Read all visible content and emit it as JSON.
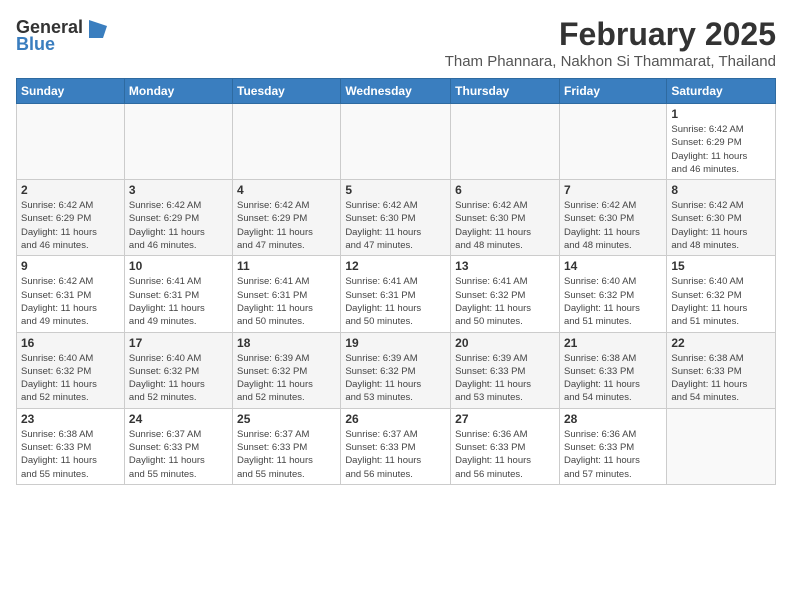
{
  "logo": {
    "general": "General",
    "blue": "Blue"
  },
  "title": {
    "main": "February 2025",
    "sub": "Tham Phannara, Nakhon Si Thammarat, Thailand"
  },
  "headers": [
    "Sunday",
    "Monday",
    "Tuesday",
    "Wednesday",
    "Thursday",
    "Friday",
    "Saturday"
  ],
  "weeks": [
    [
      {
        "day": "",
        "info": ""
      },
      {
        "day": "",
        "info": ""
      },
      {
        "day": "",
        "info": ""
      },
      {
        "day": "",
        "info": ""
      },
      {
        "day": "",
        "info": ""
      },
      {
        "day": "",
        "info": ""
      },
      {
        "day": "1",
        "info": "Sunrise: 6:42 AM\nSunset: 6:29 PM\nDaylight: 11 hours\nand 46 minutes."
      }
    ],
    [
      {
        "day": "2",
        "info": "Sunrise: 6:42 AM\nSunset: 6:29 PM\nDaylight: 11 hours\nand 46 minutes."
      },
      {
        "day": "3",
        "info": "Sunrise: 6:42 AM\nSunset: 6:29 PM\nDaylight: 11 hours\nand 46 minutes."
      },
      {
        "day": "4",
        "info": "Sunrise: 6:42 AM\nSunset: 6:29 PM\nDaylight: 11 hours\nand 47 minutes."
      },
      {
        "day": "5",
        "info": "Sunrise: 6:42 AM\nSunset: 6:30 PM\nDaylight: 11 hours\nand 47 minutes."
      },
      {
        "day": "6",
        "info": "Sunrise: 6:42 AM\nSunset: 6:30 PM\nDaylight: 11 hours\nand 48 minutes."
      },
      {
        "day": "7",
        "info": "Sunrise: 6:42 AM\nSunset: 6:30 PM\nDaylight: 11 hours\nand 48 minutes."
      },
      {
        "day": "8",
        "info": "Sunrise: 6:42 AM\nSunset: 6:30 PM\nDaylight: 11 hours\nand 48 minutes."
      }
    ],
    [
      {
        "day": "9",
        "info": "Sunrise: 6:42 AM\nSunset: 6:31 PM\nDaylight: 11 hours\nand 49 minutes."
      },
      {
        "day": "10",
        "info": "Sunrise: 6:41 AM\nSunset: 6:31 PM\nDaylight: 11 hours\nand 49 minutes."
      },
      {
        "day": "11",
        "info": "Sunrise: 6:41 AM\nSunset: 6:31 PM\nDaylight: 11 hours\nand 50 minutes."
      },
      {
        "day": "12",
        "info": "Sunrise: 6:41 AM\nSunset: 6:31 PM\nDaylight: 11 hours\nand 50 minutes."
      },
      {
        "day": "13",
        "info": "Sunrise: 6:41 AM\nSunset: 6:32 PM\nDaylight: 11 hours\nand 50 minutes."
      },
      {
        "day": "14",
        "info": "Sunrise: 6:40 AM\nSunset: 6:32 PM\nDaylight: 11 hours\nand 51 minutes."
      },
      {
        "day": "15",
        "info": "Sunrise: 6:40 AM\nSunset: 6:32 PM\nDaylight: 11 hours\nand 51 minutes."
      }
    ],
    [
      {
        "day": "16",
        "info": "Sunrise: 6:40 AM\nSunset: 6:32 PM\nDaylight: 11 hours\nand 52 minutes."
      },
      {
        "day": "17",
        "info": "Sunrise: 6:40 AM\nSunset: 6:32 PM\nDaylight: 11 hours\nand 52 minutes."
      },
      {
        "day": "18",
        "info": "Sunrise: 6:39 AM\nSunset: 6:32 PM\nDaylight: 11 hours\nand 52 minutes."
      },
      {
        "day": "19",
        "info": "Sunrise: 6:39 AM\nSunset: 6:32 PM\nDaylight: 11 hours\nand 53 minutes."
      },
      {
        "day": "20",
        "info": "Sunrise: 6:39 AM\nSunset: 6:33 PM\nDaylight: 11 hours\nand 53 minutes."
      },
      {
        "day": "21",
        "info": "Sunrise: 6:38 AM\nSunset: 6:33 PM\nDaylight: 11 hours\nand 54 minutes."
      },
      {
        "day": "22",
        "info": "Sunrise: 6:38 AM\nSunset: 6:33 PM\nDaylight: 11 hours\nand 54 minutes."
      }
    ],
    [
      {
        "day": "23",
        "info": "Sunrise: 6:38 AM\nSunset: 6:33 PM\nDaylight: 11 hours\nand 55 minutes."
      },
      {
        "day": "24",
        "info": "Sunrise: 6:37 AM\nSunset: 6:33 PM\nDaylight: 11 hours\nand 55 minutes."
      },
      {
        "day": "25",
        "info": "Sunrise: 6:37 AM\nSunset: 6:33 PM\nDaylight: 11 hours\nand 55 minutes."
      },
      {
        "day": "26",
        "info": "Sunrise: 6:37 AM\nSunset: 6:33 PM\nDaylight: 11 hours\nand 56 minutes."
      },
      {
        "day": "27",
        "info": "Sunrise: 6:36 AM\nSunset: 6:33 PM\nDaylight: 11 hours\nand 56 minutes."
      },
      {
        "day": "28",
        "info": "Sunrise: 6:36 AM\nSunset: 6:33 PM\nDaylight: 11 hours\nand 57 minutes."
      },
      {
        "day": "",
        "info": ""
      }
    ]
  ]
}
